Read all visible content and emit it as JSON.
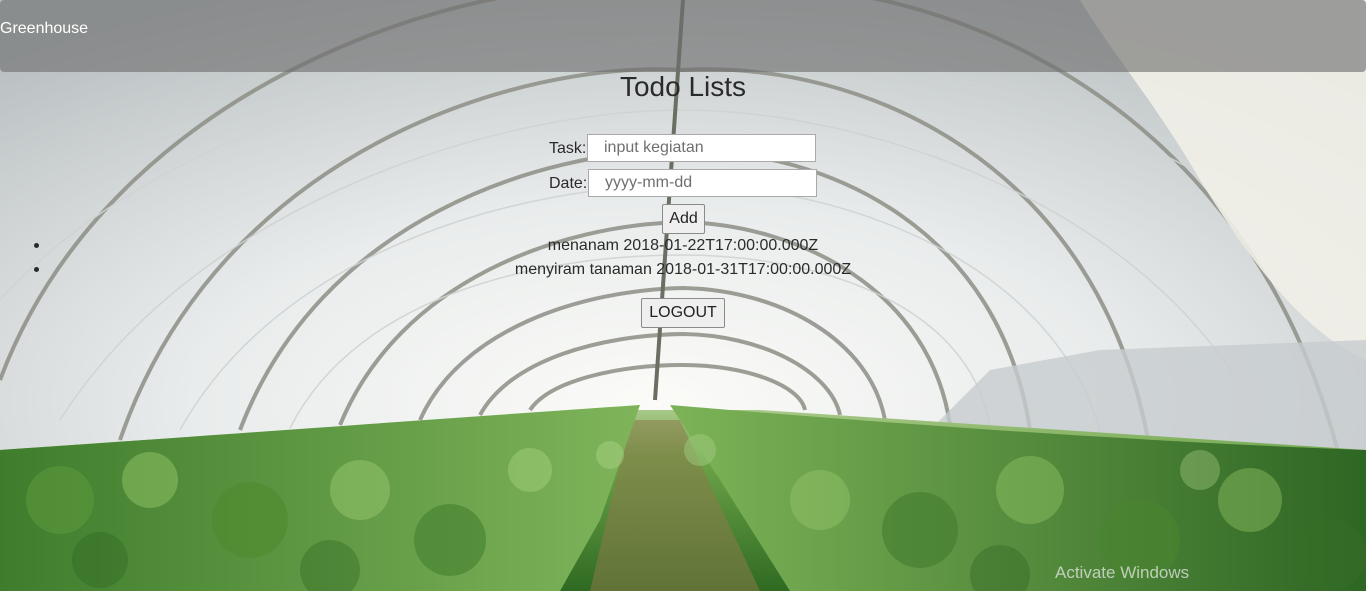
{
  "navbar": {
    "brand": "Greenhouse"
  },
  "main": {
    "title": "Todo Lists",
    "task_label": "Task:",
    "task_placeholder": "input kegiatan",
    "task_value": "",
    "date_label": "Date:",
    "date_placeholder": "yyyy-mm-dd",
    "date_value": "",
    "add_label": "Add",
    "todos": [
      {
        "text": "menanam 2018-01-22T17:00:00.000Z"
      },
      {
        "text": "menyiram tanaman 2018-01-31T17:00:00.000Z"
      }
    ],
    "logout_label": "LOGOUT"
  },
  "overlay": {
    "watermark": "Activate Windows"
  },
  "colors": {
    "navbar_bg": "#6e6e6e",
    "text": "#2a2a2a",
    "foliage": "#4c8a2c",
    "sky_plastic": "#e6e9ea"
  },
  "background": "greenhouse-photo"
}
